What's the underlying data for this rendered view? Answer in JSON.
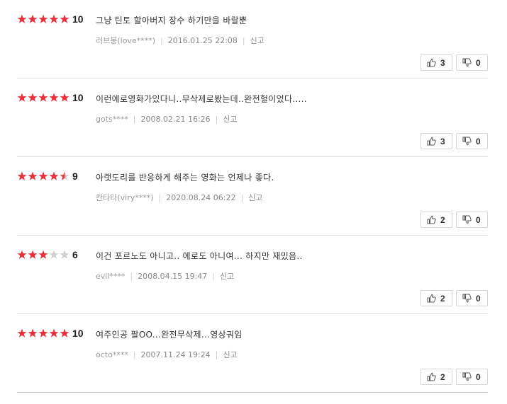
{
  "reviews": [
    {
      "rating": 10,
      "stars": 5,
      "comment": "그냥 틴토 할아버지 장수 하기만을 바랄뿐",
      "author": "러브봉(love****)",
      "date": "2016.01.25 22:08",
      "report_label": "신고",
      "likes": "3",
      "dislikes": "0"
    },
    {
      "rating": 10,
      "stars": 5,
      "comment": "이런에로영화가있다니..무삭제로봤는데..완전헐이었다.....",
      "author": "gots****",
      "date": "2008.02.21 16:26",
      "report_label": "신고",
      "likes": "3",
      "dislikes": "0"
    },
    {
      "rating": 9,
      "stars": 4.5,
      "comment": "아랫도리를 반응하게 해주는 영화는 언제나 좋다.",
      "author": "칸타타(viry****)",
      "date": "2020.08.24 06:22",
      "report_label": "신고",
      "likes": "2",
      "dislikes": "0"
    },
    {
      "rating": 6,
      "stars": 3,
      "comment": "이건 포르노도 아니고.. 에로도 아니여... 하지만 재밌음..",
      "author": "evil****",
      "date": "2008.04.15 19:47",
      "report_label": "신고",
      "likes": "2",
      "dislikes": "0"
    },
    {
      "rating": 10,
      "stars": 5,
      "comment": "여주인공 팔OO...완전무삭제...영상궈임",
      "author": "octo****",
      "date": "2007.11.24 19:24",
      "report_label": "신고",
      "likes": "2",
      "dislikes": "0"
    }
  ],
  "colors": {
    "star_on": "#e9303c",
    "star_off": "#cfcfcf"
  },
  "icons": {
    "like": "thumbs-up-icon",
    "dislike": "thumbs-down-icon",
    "star": "star-icon"
  }
}
